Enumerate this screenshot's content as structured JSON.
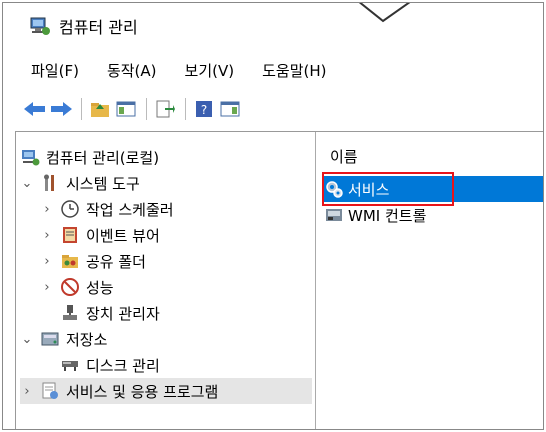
{
  "window": {
    "title": "컴퓨터 관리"
  },
  "menu": [
    {
      "label": "파일(F)"
    },
    {
      "label": "동작(A)"
    },
    {
      "label": "보기(V)"
    },
    {
      "label": "도움말(H)"
    }
  ],
  "toolbar": {
    "icons": [
      "back-arrow-icon",
      "forward-arrow-icon",
      "up-folder-icon",
      "show-hide-tree-icon",
      "export-list-icon",
      "help-icon",
      "action-pane-icon"
    ]
  },
  "tree": {
    "items": [
      {
        "label": "컴퓨터 관리(로컬)",
        "expander": "",
        "icon": "computer-management-icon"
      },
      {
        "label": "시스템 도구",
        "expander": "⌄",
        "icon": "system-tools-icon"
      },
      {
        "label": "작업 스케줄러",
        "expander": "›",
        "icon": "task-scheduler-icon"
      },
      {
        "label": "이벤트 뷰어",
        "expander": "›",
        "icon": "event-viewer-icon"
      },
      {
        "label": "공유 폴더",
        "expander": "›",
        "icon": "shared-folders-icon"
      },
      {
        "label": "성능",
        "expander": "›",
        "icon": "performance-icon"
      },
      {
        "label": "장치 관리자",
        "expander": "",
        "icon": "device-manager-icon"
      },
      {
        "label": "저장소",
        "expander": "⌄",
        "icon": "storage-icon"
      },
      {
        "label": "디스크 관리",
        "expander": "",
        "icon": "disk-management-icon"
      },
      {
        "label": "서비스 및 응용 프로그램",
        "expander": "›",
        "icon": "services-apps-icon"
      }
    ]
  },
  "list": {
    "header": "이름",
    "rows": [
      {
        "label": "서비스",
        "icon": "gear-icon",
        "selected": true
      },
      {
        "label": "WMI 컨트롤",
        "icon": "wmi-control-icon",
        "selected": false
      }
    ]
  },
  "colors": {
    "selection": "#0078d7",
    "highlight_box": "#e8141a",
    "tree_selection": "#e5e5e5"
  }
}
